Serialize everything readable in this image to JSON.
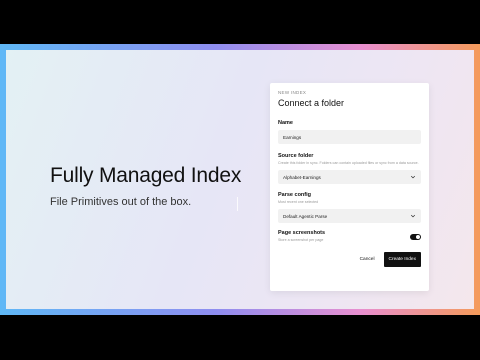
{
  "hero": {
    "title": "Fully Managed Index",
    "subtitle": "File Primitives out of the box."
  },
  "form": {
    "eyebrow": "NEW INDEX",
    "title": "Connect a folder",
    "name": {
      "label": "Name",
      "value": "Earnings"
    },
    "source_folder": {
      "label": "Source folder",
      "hint": "Create this folder in sync. Folders can contain uploaded files or sync from a data source.",
      "value": "Alphabet-Earnings"
    },
    "parse_config": {
      "label": "Parse config",
      "hint": "Most recent one selected",
      "value": "Default Agentic Parse"
    },
    "page_screenshots": {
      "label": "Page screenshots",
      "hint": "Store a screenshot per page",
      "enabled": true
    },
    "cancel_label": "Cancel",
    "create_label": "Create Index"
  },
  "icons": {
    "dropdown": "chevron-down-icon"
  },
  "colors": {
    "accent": "#111111",
    "field_bg": "#f1f1f1"
  }
}
